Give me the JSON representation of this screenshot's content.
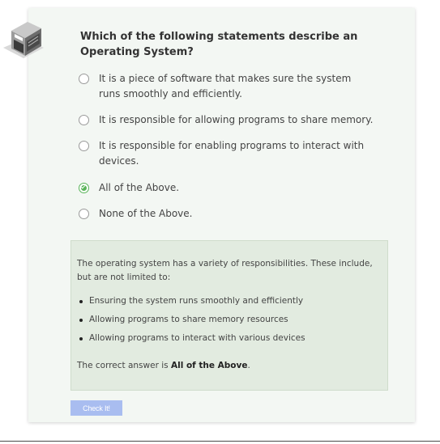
{
  "quiz": {
    "icon": "server-building-icon",
    "question": "Which of the following statements describe an Operating System?",
    "options": [
      {
        "label": "It is a piece of software that makes sure the system runs smoothly and efficiently.",
        "selected": false
      },
      {
        "label": "It is responsible for allowing programs to share memory.",
        "selected": false
      },
      {
        "label": "It is responsible for enabling programs to interact with devices.",
        "selected": false
      },
      {
        "label": "All of the Above.",
        "selected": true
      },
      {
        "label": "None of the Above.",
        "selected": false
      }
    ],
    "feedback": {
      "intro": "The operating system has a variety of responsibilities. These include, but are not limited to:",
      "bullets": [
        "Ensuring the system runs smoothly and efficiently",
        "Allowing programs to share memory resources",
        "Allowing programs to interact with various devices"
      ],
      "answer_prefix": "The correct answer is ",
      "answer_value": "All of the Above",
      "answer_suffix": "."
    },
    "check_button_label": "Check It!"
  },
  "colors": {
    "card_background": "#f3f7f3",
    "feedback_background": "#e2ebe0",
    "selected_radio": "#5ab45a",
    "check_button": "#a9bdf0"
  }
}
